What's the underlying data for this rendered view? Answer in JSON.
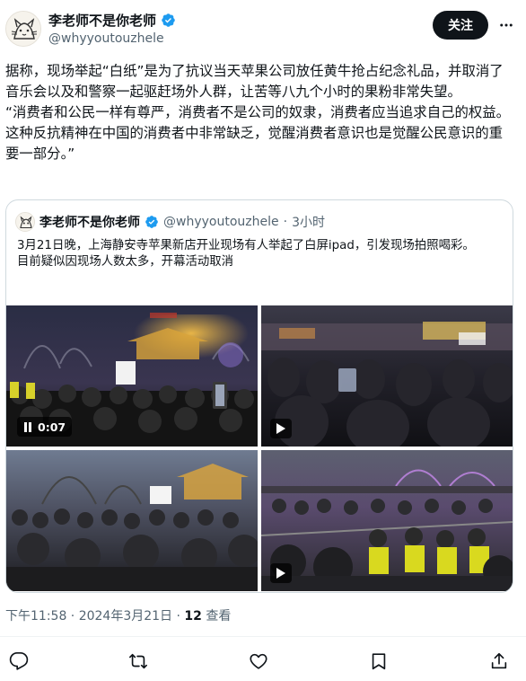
{
  "author": {
    "name": "李老师不是你老师",
    "handle": "@whyyoutouzhele",
    "follow_label": "关注",
    "verified_color": "#1d9bf0"
  },
  "tweet": {
    "paragraphs": [
      "据称，现场举起“白纸”是为了抗议当天苹果公司放任黄牛抢占纪念礼品，并取消了音乐会以及和警察一起驱赶场外人群，让苦等八九个小时的果粉非常失望。",
      "“消费者和公民一样有尊严，消费者不是公司的奴隶，消费者应当追求自己的权益。这种反抗精神在中国的消费者中非常缺乏，觉醒消费者意识也是觉醒公民意识的重要一部分。”"
    ]
  },
  "quote": {
    "name": "李老师不是你老师",
    "handle": "@whyyoutouzhele",
    "dot": "·",
    "time": "3小时",
    "lines": [
      "3月21日晚，上海静安寺苹果新店开业现场有人举起了白屏ipad，引发现场拍照喝彩。",
      "目前疑似因现场人数太多，开幕活动取消"
    ],
    "media": {
      "video_duration": "0:07",
      "tiles": [
        "video",
        "video",
        "image",
        "video"
      ]
    }
  },
  "meta": {
    "timestamp": "下午11:58 · 2024年3月21日 · ",
    "views_count": "12",
    "views_label": " 查看"
  },
  "actions": [
    "reply-icon",
    "retweet-icon",
    "like-icon",
    "bookmark-icon",
    "share-icon"
  ],
  "colors": {
    "text": "#0f1419",
    "secondary": "#536471",
    "border": "#cfd9de",
    "button_bg": "#0f1419"
  }
}
